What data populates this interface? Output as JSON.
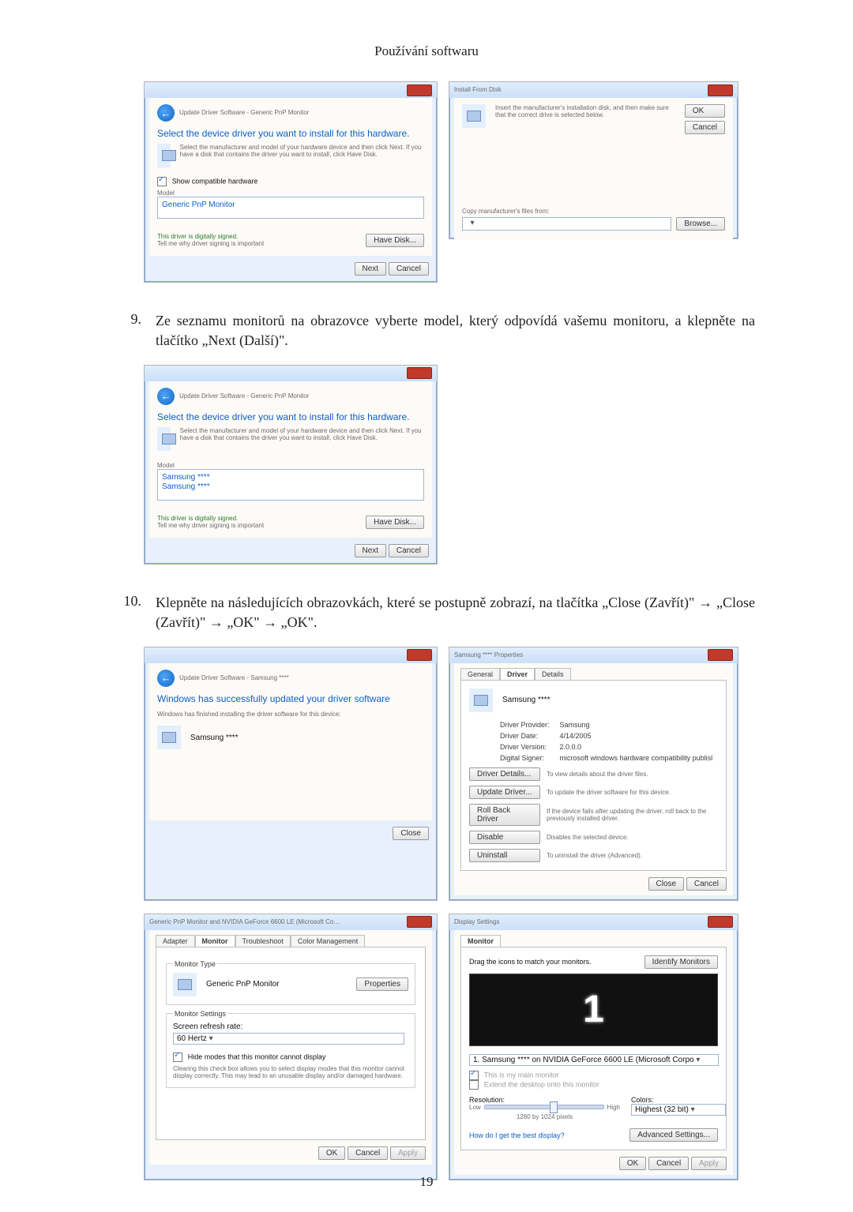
{
  "header": "Používání softwaru",
  "page_number": "19",
  "driver_select": {
    "crumb": "Update Driver Software - Generic PnP Monitor",
    "heading": "Select the device driver you want to install for this hardware.",
    "desc": "Select the manufacturer and model of your hardware device and then click Next. If you have a disk that contains the driver you want to install, click Have Disk.",
    "show_compat": "Show compatible hardware",
    "model_label": "Model",
    "model_item": "Generic PnP Monitor",
    "signed": "This driver is digitally signed.",
    "signed_link": "Tell me why driver signing is important",
    "have_disk": "Have Disk...",
    "next": "Next",
    "cancel": "Cancel"
  },
  "install_disk": {
    "title": "Install From Disk",
    "desc": "Insert the manufacturer's installation disk, and then make sure that the correct drive is selected below.",
    "ok": "OK",
    "cancel": "Cancel",
    "copy_label": "Copy manufacturer's files from:",
    "browse": "Browse..."
  },
  "step9": {
    "num": "9.",
    "text": "Ze seznamu monitorů na obrazovce vyberte model, který odpovídá vašemu monitoru, a klepněte na tlačítko „Next (Další)\"."
  },
  "driver_pick": {
    "crumb": "Update Driver Software - Generic PnP Monitor",
    "heading": "Select the device driver you want to install for this hardware.",
    "desc": "Select the manufacturer and model of your hardware device and then click Next. If you have a disk that contains the driver you want to install, click Have Disk.",
    "model_label": "Model",
    "item1": "Samsung ****",
    "item2": "Samsung ****",
    "signed": "This driver is digitally signed.",
    "signed_link": "Tell me why driver signing is important",
    "have_disk": "Have Disk...",
    "next": "Next",
    "cancel": "Cancel"
  },
  "step10": {
    "num": "10.",
    "text": "Klepněte na následujících obrazovkách, které se postupně zobrazí, na tlačítka „Close (Zavřít)\" → „Close (Zavřít)\" → „OK\" → „OK\"."
  },
  "driver_done": {
    "crumb": "Update Driver Software - Samsung ****",
    "heading": "Windows has successfully updated your driver software",
    "desc": "Windows has finished installing the driver software for this device:",
    "device": "Samsung ****",
    "close": "Close"
  },
  "driver_props": {
    "title": "Samsung **** Properties",
    "tab_general": "General",
    "tab_driver": "Driver",
    "tab_details": "Details",
    "device": "Samsung ****",
    "rows": {
      "provider_l": "Driver Provider:",
      "provider_v": "Samsung",
      "date_l": "Driver Date:",
      "date_v": "4/14/2005",
      "version_l": "Driver Version:",
      "version_v": "2.0.0.0",
      "signer_l": "Digital Signer:",
      "signer_v": "microsoft windows hardware compatibility publisl"
    },
    "btns": {
      "details": "Driver Details...",
      "details_d": "To view details about the driver files.",
      "update": "Update Driver...",
      "update_d": "To update the driver software for this device.",
      "rollback": "Roll Back Driver",
      "rollback_d": "If the device fails after updating the driver, roll back to the previously installed driver.",
      "disable": "Disable",
      "disable_d": "Disables the selected device.",
      "uninstall": "Uninstall",
      "uninstall_d": "To uninstall the driver (Advanced)."
    },
    "close": "Close",
    "cancel": "Cancel"
  },
  "gpu_props": {
    "title": "Generic PnP Monitor and NVIDIA GeForce 6600 LE (Microsoft Co…",
    "tab_adapter": "Adapter",
    "tab_monitor": "Monitor",
    "tab_trouble": "Troubleshoot",
    "tab_color": "Color Management",
    "type_legend": "Monitor Type",
    "type_val": "Generic PnP Monitor",
    "properties": "Properties",
    "settings_legend": "Monitor Settings",
    "refresh_label": "Screen refresh rate:",
    "refresh_val": "60 Hertz",
    "hide": "Hide modes that this monitor cannot display",
    "hide_desc": "Clearing this check box allows you to select display modes that this monitor cannot display correctly. This may lead to an unusable display and/or damaged hardware.",
    "ok": "OK",
    "cancel": "Cancel",
    "apply": "Apply"
  },
  "display_settings": {
    "title": "Display Settings",
    "tab_monitor": "Monitor",
    "drag": "Drag the icons to match your monitors.",
    "identify": "Identify Monitors",
    "device": "1. Samsung **** on NVIDIA GeForce 6600 LE (Microsoft Corpo",
    "main": "This is my main monitor",
    "extend": "Extend the desktop onto this monitor",
    "resolution_l": "Resolution:",
    "low": "Low",
    "high": "High",
    "res_val": "1280 by 1024 pixels",
    "colors_l": "Colors:",
    "colors_v": "Highest (32 bit)",
    "best": "How do I get the best display?",
    "advanced": "Advanced Settings...",
    "ok": "OK",
    "cancel": "Cancel",
    "apply": "Apply"
  }
}
